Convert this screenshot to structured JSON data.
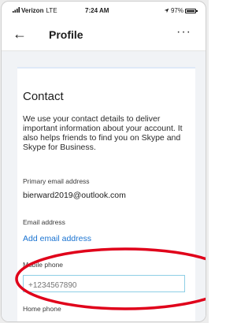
{
  "status_bar": {
    "carrier": "Verizon",
    "network": "LTE",
    "time": "7:24 AM",
    "battery": "97%",
    "battery_level": 0.97
  },
  "nav": {
    "back_icon": "arrow-left",
    "title": "Profile",
    "more_icon": "ellipsis"
  },
  "contact": {
    "heading": "Contact",
    "description": "We use your contact details to deliver important information about your account. It also helps friends to find you on Skype and Skype for Business.",
    "primary_email_label": "Primary email address",
    "primary_email_value": "bierward2019@outlook.com",
    "email_label": "Email address",
    "add_email_link": "Add email address",
    "mobile_label": "Mobile phone",
    "mobile_placeholder": "+1234567890",
    "home_label": "Home phone"
  },
  "annotation": {
    "highlight_color": "#e0001a"
  }
}
